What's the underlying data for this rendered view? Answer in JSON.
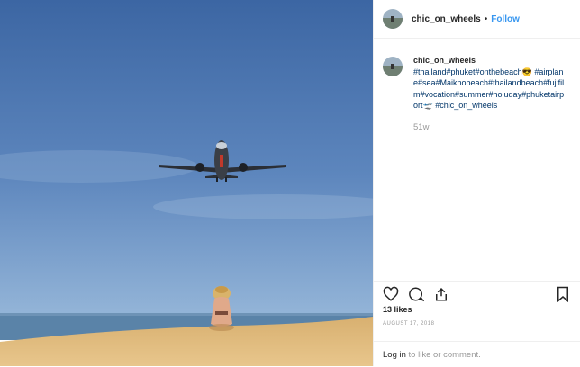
{
  "header": {
    "username": "chic_on_wheels",
    "separator": "•",
    "follow_label": "Follow"
  },
  "caption": {
    "username": "chic_on_wheels",
    "hashtags": "#thailand#phuket#onthebeach😎 #airplane#sea#Maikhobeach#thailandbeach#fujifilm#vocation#summer#holuday#phuketairport🛫 #chic_on_wheels",
    "time_ago": "51w"
  },
  "stats": {
    "likes": "13 likes",
    "date": "AUGUST 17, 2018"
  },
  "comment": {
    "login_link": "Log in",
    "rest": " to like or comment."
  },
  "icons": {
    "like": "heart-icon",
    "comment": "comment-icon",
    "share": "share-icon",
    "save": "bookmark-icon"
  },
  "colors": {
    "follow": "#3897f0",
    "hashtag": "#003569",
    "sky_top": "#3f6aa6",
    "sky_bottom": "#8fb2d6",
    "sea": "#5a83a8",
    "sand": "#e3bd7e"
  }
}
